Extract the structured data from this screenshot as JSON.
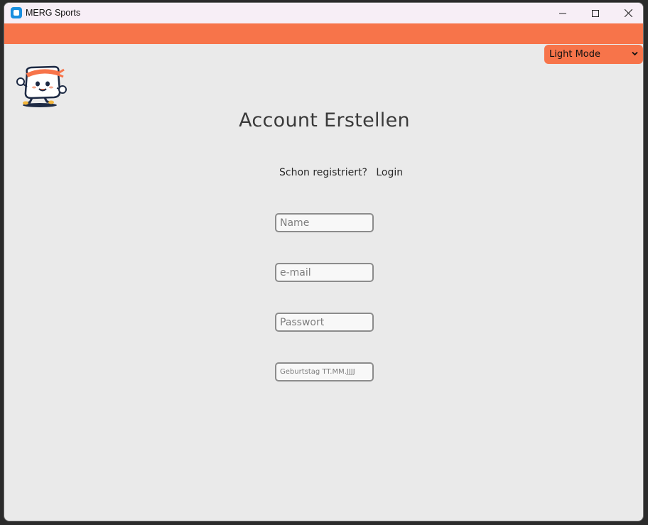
{
  "window": {
    "title": "MERG Sports"
  },
  "header": {
    "theme_selector": {
      "selected": "Light Mode"
    }
  },
  "main": {
    "heading": "Account Erstellen",
    "already_registered": "Schon registriert?",
    "login_link": "Login",
    "fields": {
      "name_placeholder": "Name",
      "email_placeholder": "e-mail",
      "password_placeholder": "Passwort",
      "birthday_placeholder": "Geburtstag TT.MM.JJJJ"
    }
  },
  "colors": {
    "accent": "#f7744a",
    "background": "#eaeaea",
    "titlebar": "#f7eef6"
  }
}
